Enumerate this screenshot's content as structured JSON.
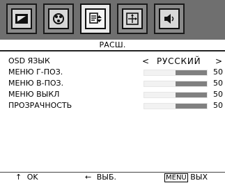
{
  "tabs": [
    {
      "icon": "picture-icon",
      "selected": false
    },
    {
      "icon": "color-icon",
      "selected": false
    },
    {
      "icon": "extended-settings-icon",
      "selected": true
    },
    {
      "icon": "image-position-icon",
      "selected": false
    },
    {
      "icon": "sound-icon",
      "selected": false
    }
  ],
  "panel": {
    "title": "РАСШ.",
    "rows": {
      "osd_language": {
        "label": "OSD ЯЗЫК",
        "left": "<",
        "value": "РУССКИЙ",
        "right": ">"
      },
      "menu_h_pos": {
        "label": "МЕНЮ Г-ПОЗ.",
        "value": "50",
        "level": 50
      },
      "menu_v_pos": {
        "label": "МЕНЮ В-ПОЗ.",
        "value": "50",
        "level": 50
      },
      "menu_off": {
        "label": "МЕНЮ ВЫКЛ",
        "value": "50",
        "level": 50
      },
      "transparency": {
        "label": "ПРОЗРАЧНОСТЬ",
        "value": "50",
        "level": 50
      }
    }
  },
  "hints": {
    "ok": {
      "arrow": "↑",
      "label": "OK"
    },
    "select": {
      "arrow": "←",
      "label": "ВЫБ."
    },
    "exit": {
      "key": "MENU",
      "label": "ВЫХ"
    }
  },
  "colors": {
    "tab_bar": "#6f6f6f",
    "slider_fill": "#808080",
    "slider_track": "#f2f2f2"
  }
}
